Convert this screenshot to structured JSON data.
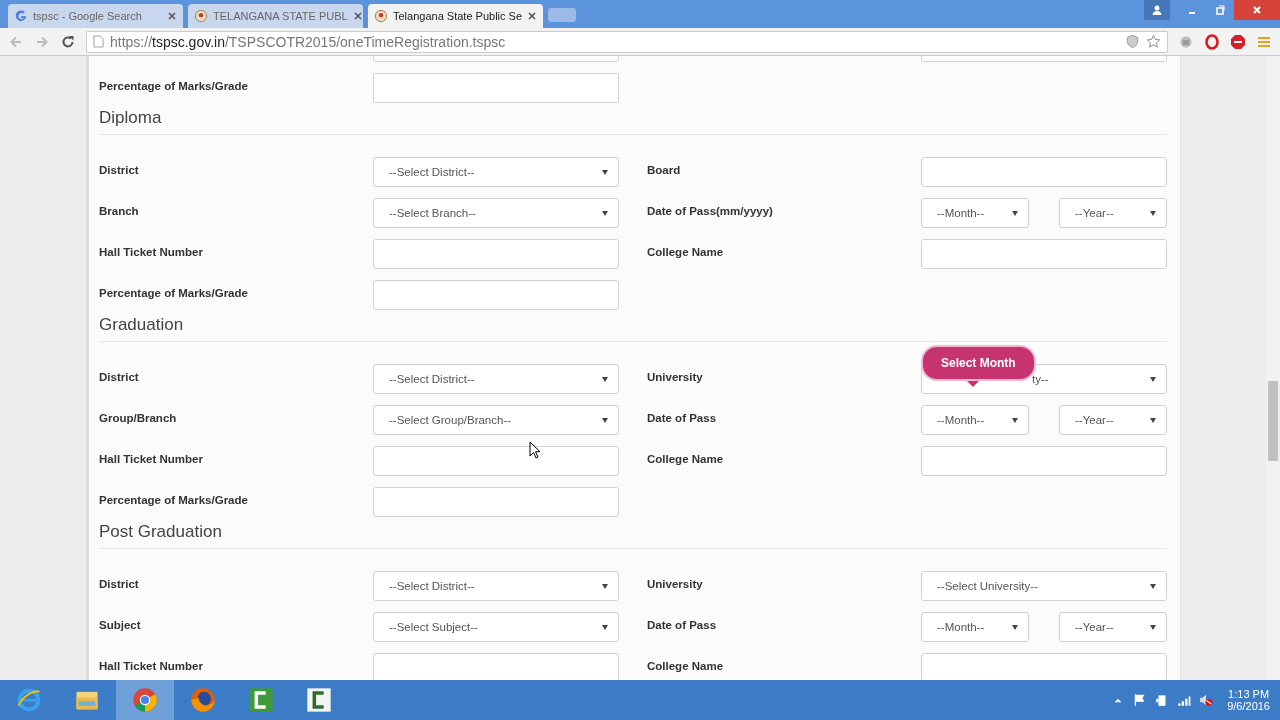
{
  "browser": {
    "tabs": [
      {
        "title": "tspsc - Google Search",
        "selected": false
      },
      {
        "title": "TELANGANA STATE PUBL",
        "selected": false
      },
      {
        "title": "Telangana State Public Se",
        "selected": true
      }
    ],
    "address": {
      "scheme": "https://",
      "host": "tspsc.gov.in",
      "path": "/TSPSCOTR2015/oneTimeRegistration.tspsc"
    }
  },
  "sections": [
    {
      "rows": [
        {
          "left": {
            "control": {
              "kind": "input"
            }
          },
          "right": {
            "control": {
              "kind": "input"
            }
          }
        },
        {
          "left": {
            "label": "Percentage of Marks/Grade",
            "control": {
              "kind": "input"
            }
          }
        }
      ]
    },
    {
      "title": "Diploma",
      "rows": [
        {
          "left": {
            "label": "District",
            "control": {
              "kind": "select",
              "text": "--Select District--"
            }
          },
          "right": {
            "label": "Board",
            "control": {
              "kind": "input"
            }
          }
        },
        {
          "left": {
            "label": "Branch",
            "control": {
              "kind": "select",
              "text": "--Select Branch--"
            }
          },
          "right": {
            "label": "Date of Pass(mm/yyyy)",
            "control": {
              "kind": "monthyear",
              "month": "--Month--",
              "year": "--Year--"
            }
          }
        },
        {
          "left": {
            "label": "Hall Ticket Number",
            "control": {
              "kind": "input"
            }
          },
          "right": {
            "label": "College Name",
            "control": {
              "kind": "input"
            }
          }
        },
        {
          "left": {
            "label": "Percentage of Marks/Grade",
            "control": {
              "kind": "input"
            }
          }
        }
      ]
    },
    {
      "title": "Graduation",
      "rows": [
        {
          "left": {
            "label": "District",
            "control": {
              "kind": "select",
              "text": "--Select District--"
            }
          },
          "right": {
            "label": "University",
            "control": {
              "kind": "select",
              "text": "ty--",
              "covered": true
            },
            "tooltip": "Select Month"
          }
        },
        {
          "left": {
            "label": "Group/Branch",
            "control": {
              "kind": "select",
              "text": "--Select Group/Branch--"
            }
          },
          "right": {
            "label": "Date of Pass",
            "control": {
              "kind": "monthyear",
              "month": "--Month--",
              "year": "--Year--"
            }
          }
        },
        {
          "left": {
            "label": "Hall Ticket Number",
            "control": {
              "kind": "input"
            }
          },
          "right": {
            "label": "College Name",
            "control": {
              "kind": "input"
            }
          }
        },
        {
          "left": {
            "label": "Percentage of Marks/Grade",
            "control": {
              "kind": "input"
            }
          }
        }
      ]
    },
    {
      "title": "Post Graduation",
      "rows": [
        {
          "left": {
            "label": "District",
            "control": {
              "kind": "select",
              "text": "--Select District--"
            }
          },
          "right": {
            "label": "University",
            "control": {
              "kind": "select",
              "text": "--Select University--"
            }
          }
        },
        {
          "left": {
            "label": "Subject",
            "control": {
              "kind": "select",
              "text": "--Select Subject--"
            }
          },
          "right": {
            "label": "Date of Pass",
            "control": {
              "kind": "monthyear",
              "month": "--Month--",
              "year": "--Year--"
            }
          }
        },
        {
          "left": {
            "label": "Hall Ticket Number",
            "control": {
              "kind": "input"
            }
          },
          "right": {
            "label": "College Name",
            "control": {
              "kind": "input"
            }
          }
        }
      ]
    }
  ],
  "taskbar": {
    "apps": [
      {
        "kind": "ie",
        "selected": false
      },
      {
        "kind": "folder",
        "selected": false
      },
      {
        "kind": "chrome",
        "selected": true
      },
      {
        "kind": "firefox",
        "selected": false
      },
      {
        "kind": "camtasia",
        "selected": false
      },
      {
        "kind": "recorder",
        "selected": false
      }
    ],
    "time": "1:13 PM",
    "date": "9/6/2016"
  }
}
